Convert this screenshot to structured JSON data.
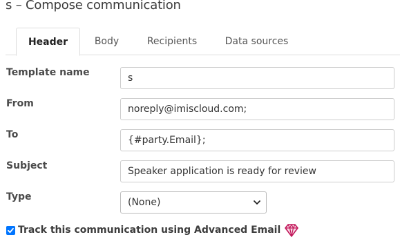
{
  "page": {
    "title": "s – Compose communication"
  },
  "tabs": [
    {
      "label": "Header",
      "active": true
    },
    {
      "label": "Body",
      "active": false
    },
    {
      "label": "Recipients",
      "active": false
    },
    {
      "label": "Data sources",
      "active": false
    }
  ],
  "form": {
    "template_name": {
      "label": "Template name",
      "value": "s"
    },
    "from": {
      "label": "From",
      "value": "noreply@imiscloud.com;"
    },
    "to": {
      "label": "To",
      "value": "{#party.Email};"
    },
    "subject": {
      "label": "Subject",
      "value": "Speaker application is ready for review"
    },
    "type": {
      "label": "Type",
      "selected": "(None)"
    }
  },
  "track": {
    "label": "Track this communication using Advanced Email",
    "checked": true,
    "icon": "gem-icon",
    "icon_color": "#c2185b"
  },
  "colors": {
    "checkbox": "#0075ff",
    "border": "#cccccc"
  }
}
